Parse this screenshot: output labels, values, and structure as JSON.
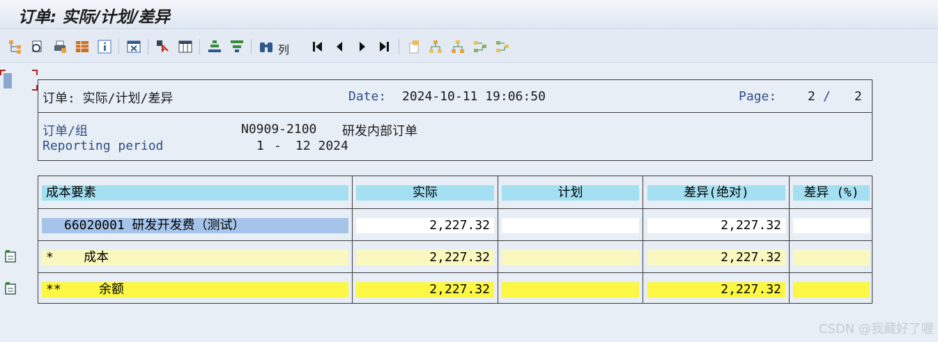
{
  "window": {
    "title": "订单: 实际/计划/差异"
  },
  "toolbar": {
    "icons": [
      "hierarchy-icon",
      "report-icon",
      "print-icon",
      "layout-icon",
      "info-icon",
      "excel-icon",
      "select-icon",
      "columns-icon",
      "sort-asc-icon",
      "filter-icon",
      "binoculars-icon",
      "first-page-icon",
      "prev-page-icon",
      "next-page-icon",
      "last-page-icon",
      "expand-icon",
      "tree-icon",
      "tree2-icon",
      "tree3-icon",
      "tree4-icon"
    ],
    "columns_label": "列"
  },
  "header": {
    "report_title": "订单: 实际/计划/差异",
    "date_label": "Date:",
    "date_value": "2024-10-11 19:06:50",
    "page_label": "Page:",
    "page_current": "2",
    "page_sep": "/",
    "page_total": "2",
    "order_label": "订单/组",
    "order_value": "N0909-2100",
    "order_desc": "研发内部订单",
    "period_label": "Reporting period",
    "period_from": "1",
    "period_dash": "-",
    "period_to": "12 2024"
  },
  "table": {
    "columns": [
      "成本要素",
      "实际",
      "计划",
      "差异(绝对)",
      "差异 (%)"
    ],
    "rows": [
      {
        "element": "66020001  研发开发费（测试）",
        "actual": "2,227.32",
        "plan": "",
        "var_abs": "2,227.32",
        "var_pct": ""
      },
      {
        "element": "*    成本",
        "actual": "2,227.32",
        "plan": "",
        "var_abs": "2,227.32",
        "var_pct": ""
      },
      {
        "element": "**     余额",
        "actual": "2,227.32",
        "plan": "",
        "var_abs": "2,227.32",
        "var_pct": ""
      }
    ]
  },
  "watermark": "CSDN @我藏好了喔",
  "colors": {
    "header_cell": "#a4e0f1",
    "subtotal": "#fbf8bf",
    "total": "#fbf744",
    "selected": "#a6c4ea"
  }
}
